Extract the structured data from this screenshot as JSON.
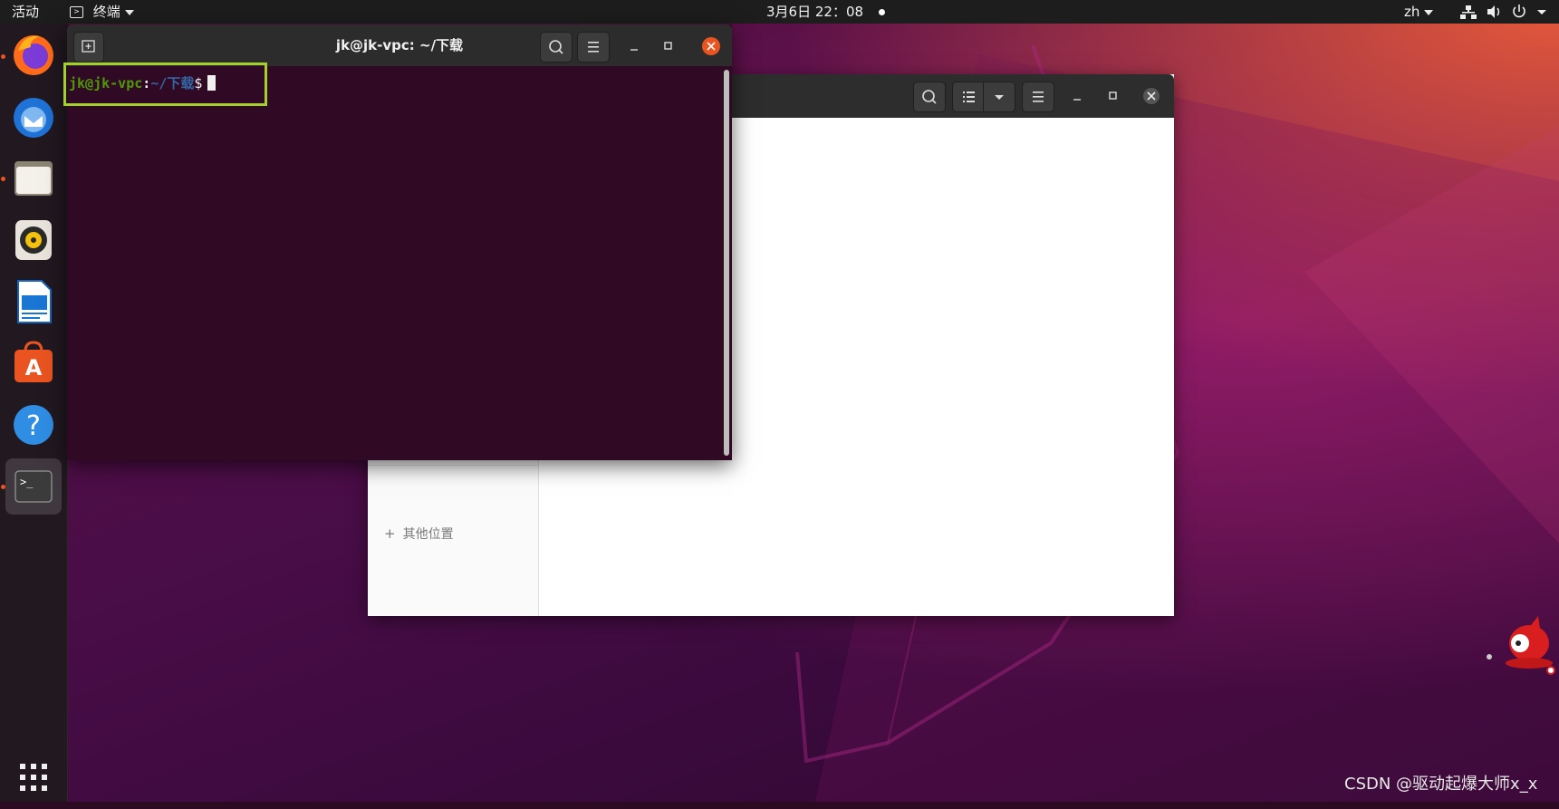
{
  "topbar": {
    "activities": "活动",
    "app_menu": "终端",
    "clock": "3月6日 22：08",
    "lang": "zh"
  },
  "dock": {
    "items": [
      {
        "name": "firefox",
        "running": true
      },
      {
        "name": "thunderbird",
        "running": false
      },
      {
        "name": "files",
        "running": true
      },
      {
        "name": "rhythmbox",
        "running": false
      },
      {
        "name": "libreoffice-writer",
        "running": false
      },
      {
        "name": "ubuntu-software",
        "running": false
      },
      {
        "name": "help",
        "running": false
      },
      {
        "name": "terminal",
        "running": true,
        "active": true
      }
    ]
  },
  "terminal": {
    "title": "jk@jk-vpc: ~/下载",
    "prompt_user": "jk@jk-vpc",
    "prompt_sep": ":",
    "prompt_path": "~/下载",
    "prompt_symbol": "$"
  },
  "files": {
    "other_places": "其他位置"
  },
  "watermark": "CSDN @驱动起爆大师x_x",
  "colors": {
    "terminal_bg": "#300a24",
    "prompt_user": "#4e9a06",
    "prompt_path": "#3465a4",
    "highlight_border": "#a3d12a",
    "close_button": "#e95420"
  }
}
